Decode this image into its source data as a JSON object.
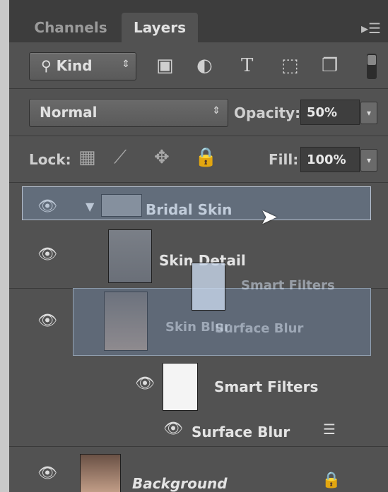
{
  "tabs": [
    {
      "label": "Channels",
      "active": false
    },
    {
      "label": "Layers",
      "active": true
    }
  ],
  "panel_menu_icon": "panel-menu-icon",
  "filter": {
    "kind_label": "Kind",
    "kind_icon": "search-icon",
    "filter_icons": [
      "image-filter-icon",
      "adjustment-filter-icon",
      "type-filter-icon",
      "shape-filter-icon",
      "smart-object-filter-icon"
    ]
  },
  "blend": {
    "mode": "Normal",
    "opacity_label": "Opacity:",
    "opacity_value": "50%"
  },
  "lock": {
    "label": "Lock:",
    "icons": [
      "lock-pixels-icon",
      "lock-brush-icon",
      "lock-position-icon",
      "lock-all-icon"
    ],
    "fill_label": "Fill:",
    "fill_value": "100%"
  },
  "layers": [
    {
      "name": "Bridal Skin",
      "type": "group"
    },
    {
      "name": "Skin Detail",
      "type": "smart-object"
    },
    {
      "name": "Smart Filters",
      "type": "smart-filters"
    },
    {
      "name": "Skin Blur",
      "type": "smart-object"
    },
    {
      "name": "Surface Blur",
      "type": "filter"
    },
    {
      "name": "Smart Filters",
      "type": "smart-filters"
    },
    {
      "name": "Surface Blur",
      "type": "filter"
    },
    {
      "name": "Background",
      "type": "background",
      "locked": true
    }
  ],
  "colors": {
    "panel": "#525252",
    "tabbar": "#3d3d3d",
    "drag_highlight": "#8aa0c8"
  }
}
